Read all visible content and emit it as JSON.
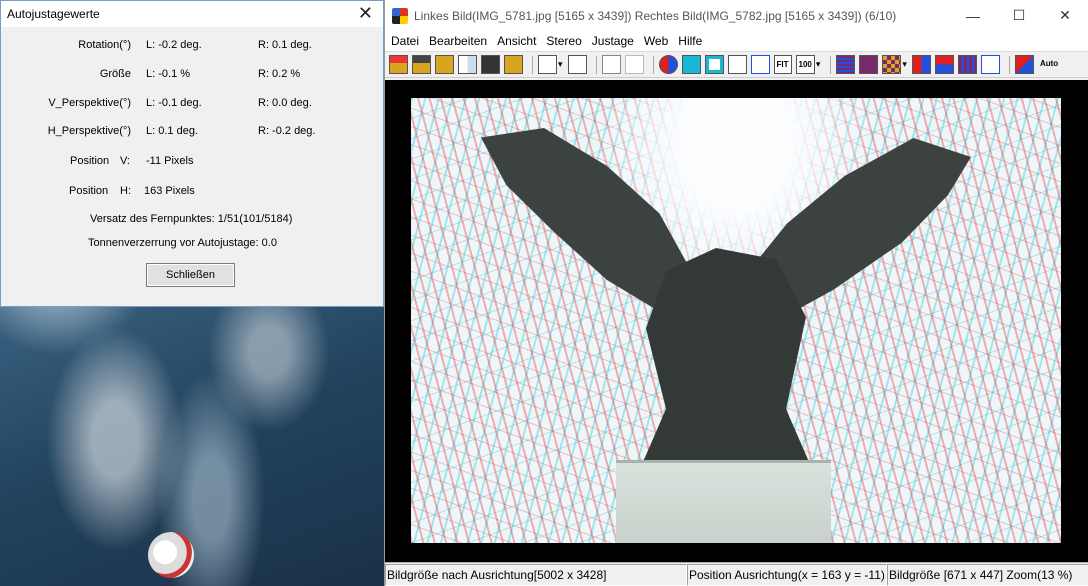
{
  "dialog": {
    "title": "Autojustagewerte",
    "close_glyph": "✕",
    "rows": [
      {
        "label": "Rotation(°)",
        "left": "L:  -0.2 deg.",
        "right": "R:  0.1 deg."
      },
      {
        "label": "Größe",
        "left": "L:  -0.1 %",
        "right": "R:  0.2 %"
      },
      {
        "label": "V_Perspektive(°)",
        "left": "L:  -0.1 deg.",
        "right": "R:  0.0 deg."
      },
      {
        "label": "H_Perspektive(°)",
        "left": "L:  0.1 deg.",
        "right": "R:  -0.2 deg."
      }
    ],
    "position_v": {
      "label": "Position",
      "axis": "V:",
      "value": "-11 Pixels"
    },
    "position_h": {
      "label": "Position",
      "axis": "H:",
      "value": "163 Pixels"
    },
    "vanishing_offset": "Versatz des Fernpunktes: 1/51(101/5184)",
    "barrel_distortion": "Tonnenverzerrung vor Autojustage: 0.0",
    "close_button_label": "Schließen"
  },
  "window": {
    "title": "Linkes Bild(IMG_5781.jpg [5165 x 3439]) Rechtes Bild(IMG_5782.jpg [5165 x 3439])  (6/10)",
    "minimize_glyph": "—",
    "maximize_glyph": "☐",
    "close_glyph": "✕"
  },
  "menu": [
    "Datei",
    "Bearbeiten",
    "Ansicht",
    "Stereo",
    "Justage",
    "Web",
    "Hilfe"
  ],
  "toolbar": {
    "fit_label": "FIT",
    "zoom100_label": "100",
    "auto_label": "Auto",
    "dropdown_glyph": "▾",
    "colors": {
      "open": "#d9a520",
      "save": "#333333",
      "red": "#e02020",
      "blue": "#2050e0",
      "purple": "#7a2a6a",
      "cyan": "#19b7d6"
    }
  },
  "status": {
    "size_after_alignment": "Bildgröße nach Ausrichtung[5002 x 3428]",
    "position_alignment": "Position Ausrichtung(x = 163 y = -11)",
    "image_size_zoom": "Bildgröße [671 x 447]  Zoom(13 %)"
  }
}
